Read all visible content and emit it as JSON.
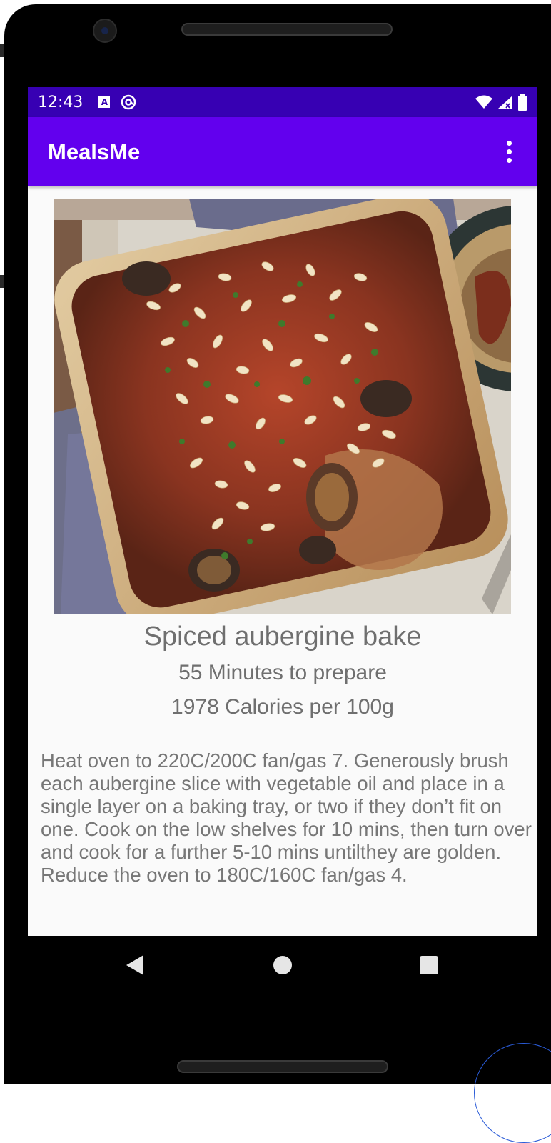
{
  "status_bar": {
    "time": "12:43",
    "icons_left": [
      "a-box-icon",
      "at-sign-icon"
    ],
    "icons_right": [
      "wifi-icon",
      "signal-icon",
      "battery-icon"
    ],
    "color": "#3700b3"
  },
  "app_bar": {
    "title": "MealsMe",
    "color": "#6200ee",
    "menu_icon": "more-vert-icon"
  },
  "recipe": {
    "name": "Spiced aubergine bake",
    "prep_time": "55 Minutes to prepare",
    "calories": "1978 Calories per 100g",
    "instructions": "Heat oven to 220C/200C fan/gas 7. Generously brush each aubergine slice with vegetable oil and place in a single layer on a baking tray, or two if they don’t fit on one. Cook on the low shelves for 10 mins, then turn over and cook for a further 5-10 mins untilthey are golden. Reduce the oven to 180C/160C fan/gas 4."
  },
  "nav_bar": {
    "buttons": [
      "back-icon",
      "home-icon",
      "recents-icon"
    ]
  }
}
